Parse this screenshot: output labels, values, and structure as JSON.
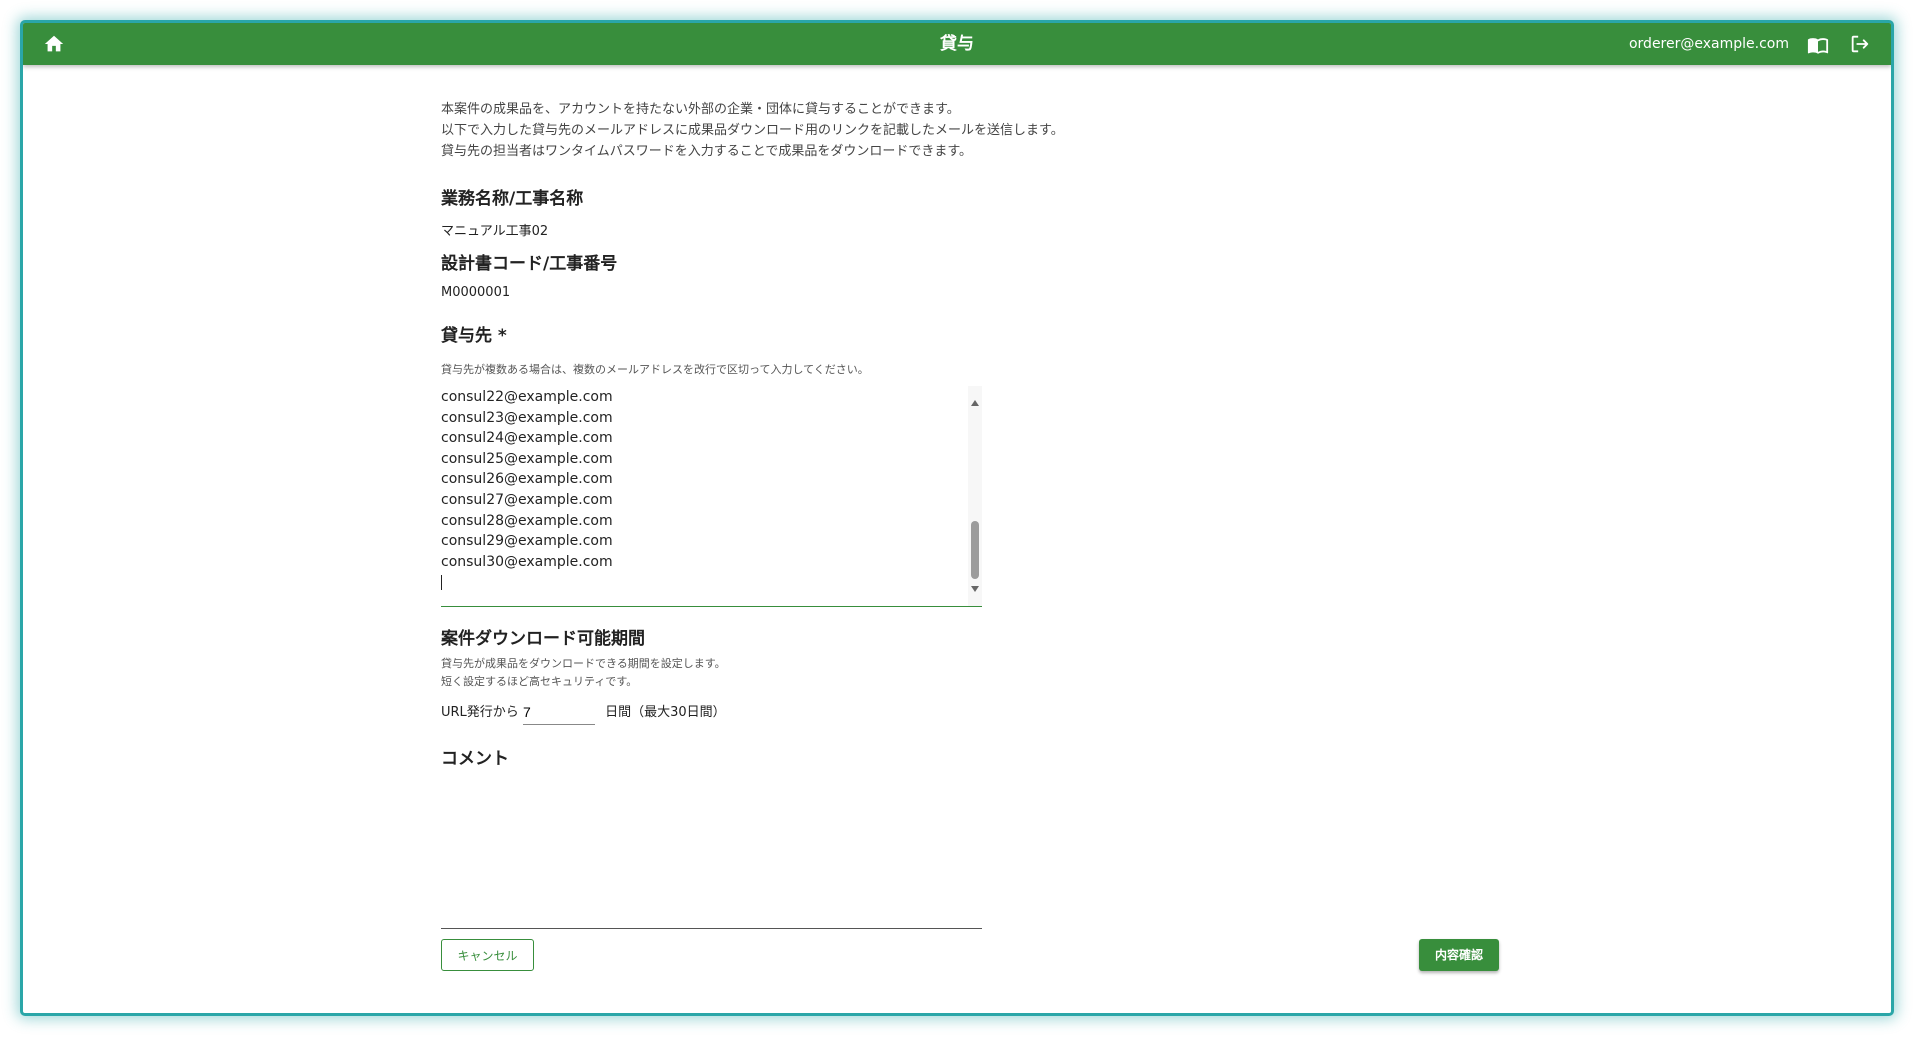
{
  "header": {
    "title": "貸与",
    "user_email": "orderer@example.com",
    "icons": {
      "home": "home-icon",
      "manual": "book-icon",
      "logout": "logout-icon"
    },
    "bar_color": "#388e3c"
  },
  "intro": {
    "lines": [
      "本案件の成果品を、アカウントを持たない外部の企業・団体に貸与することができます。",
      "以下で入力した貸与先のメールアドレスに成果品ダウンロード用のリンクを記載したメールを送信します。",
      "貸与先の担当者はワンタイムパスワードを入力することで成果品をダウンロードできます。"
    ]
  },
  "project": {
    "name_label": "業務名称/工事名称",
    "name_value": "マニュアル工事02",
    "code_label": "設計書コード/工事番号",
    "code_value": "M0000001"
  },
  "recipients": {
    "label": "貸与先 *",
    "helper": "貸与先が複数ある場合は、複数のメールアドレスを改行で区切って入力してください。",
    "visible_lines": [
      "consul22@example.com",
      "consul23@example.com",
      "consul24@example.com",
      "consul25@example.com",
      "consul26@example.com",
      "consul27@example.com",
      "consul28@example.com",
      "consul29@example.com",
      "consul30@example.com"
    ]
  },
  "download_period": {
    "label": "案件ダウンロード可能期間",
    "helper_lines": [
      "貸与先が成果品をダウンロードできる期間を設定します。",
      "短く設定するほど高セキュリティです。"
    ],
    "prefix": "URL発行から",
    "value": "7",
    "suffix": "日間（最大30日間）"
  },
  "comment": {
    "label": "コメント",
    "value": ""
  },
  "actions": {
    "cancel_label": "キャンセル",
    "confirm_label": "内容確認"
  },
  "colors": {
    "primary": "#388e3c",
    "frame_border": "#2aa6a8"
  }
}
